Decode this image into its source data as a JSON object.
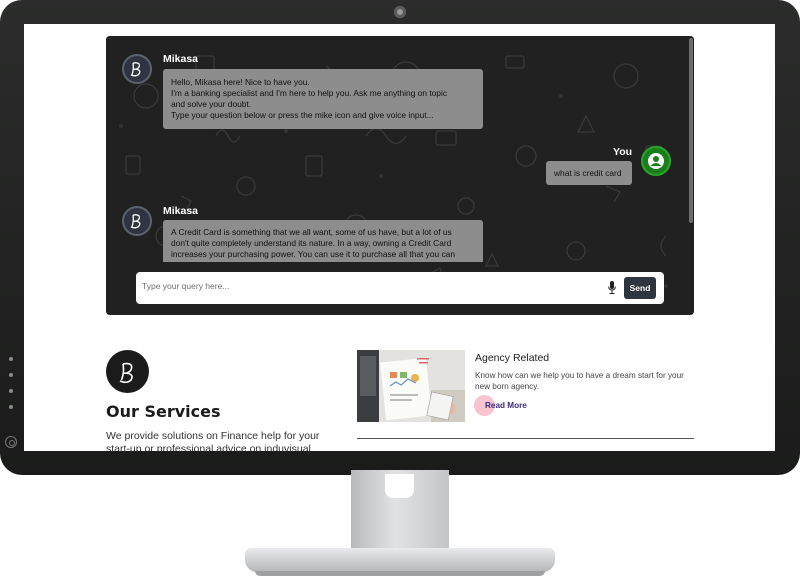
{
  "chat": {
    "messages": [
      {
        "sender": "Mikasa",
        "lines": [
          "Hello, Mikasa here! Nice to have you.",
          "I'm a banking specialist and I'm here to help you. Ask me anything on topic",
          "and solve your doubt.",
          "Type your question below or press the mike icon and give voice input..."
        ]
      },
      {
        "sender": "You",
        "text": "what is credit card"
      },
      {
        "sender": "Mikasa",
        "lines": [
          "A Credit Card is something that we all want, some of us have, but a lot of us",
          "don't quite completely understand its nature. In a way, owning a Credit Card",
          "increases your purchasing power. You can use it to purchase all that you can"
        ]
      }
    ],
    "input": {
      "placeholder": "Type your query here...",
      "value": ""
    },
    "send_label": "Send",
    "icons": {
      "bot_avatar": "b-logo-icon",
      "user_avatar": "user-circle-icon",
      "mic": "microphone-icon"
    },
    "colors": {
      "panel": "#222222",
      "bubble": "#8d8d8d",
      "send": "#2e3440",
      "you_avatar": "#1a7f1a"
    }
  },
  "services": {
    "title": "Our Services",
    "description": "We provide solutions on Finance help for your start-up or professional advice on induvisual"
  },
  "card": {
    "title": "Agency Related",
    "description": "Know how can we help you to have a dream start for your new born agency.",
    "link": "Read More"
  }
}
